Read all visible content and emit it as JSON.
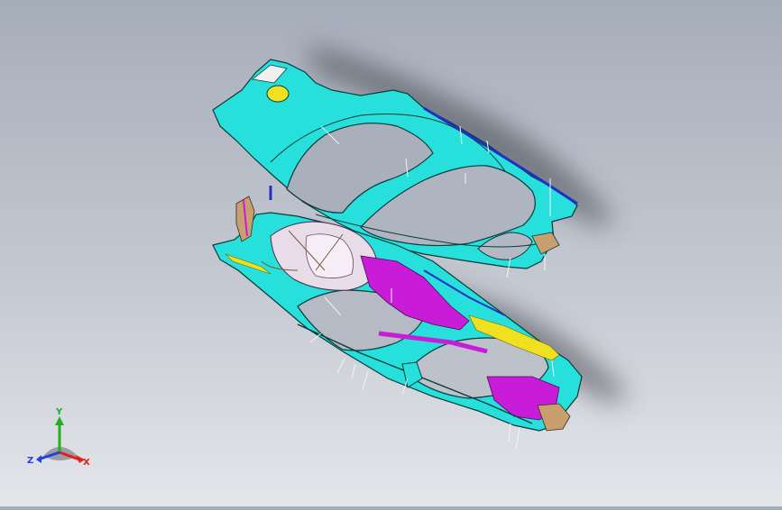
{
  "viewport": {
    "background_top": "#a6adba",
    "background_bottom": "#e4e6ea",
    "model": {
      "upper_frame_color": "#27e0dc",
      "lower_frame_color": "#27e0dc",
      "accent_magenta": "#c81cd8",
      "accent_yellow": "#f0e020",
      "accent_blue": "#2030c0",
      "accent_tan": "#c8a070",
      "edge_color": "#0a3a3a"
    }
  },
  "triad": {
    "x_label": "X",
    "y_label": "Y",
    "z_label": "Z",
    "x_color": "#e02020",
    "y_color": "#20b020",
    "z_color": "#2040e0"
  }
}
